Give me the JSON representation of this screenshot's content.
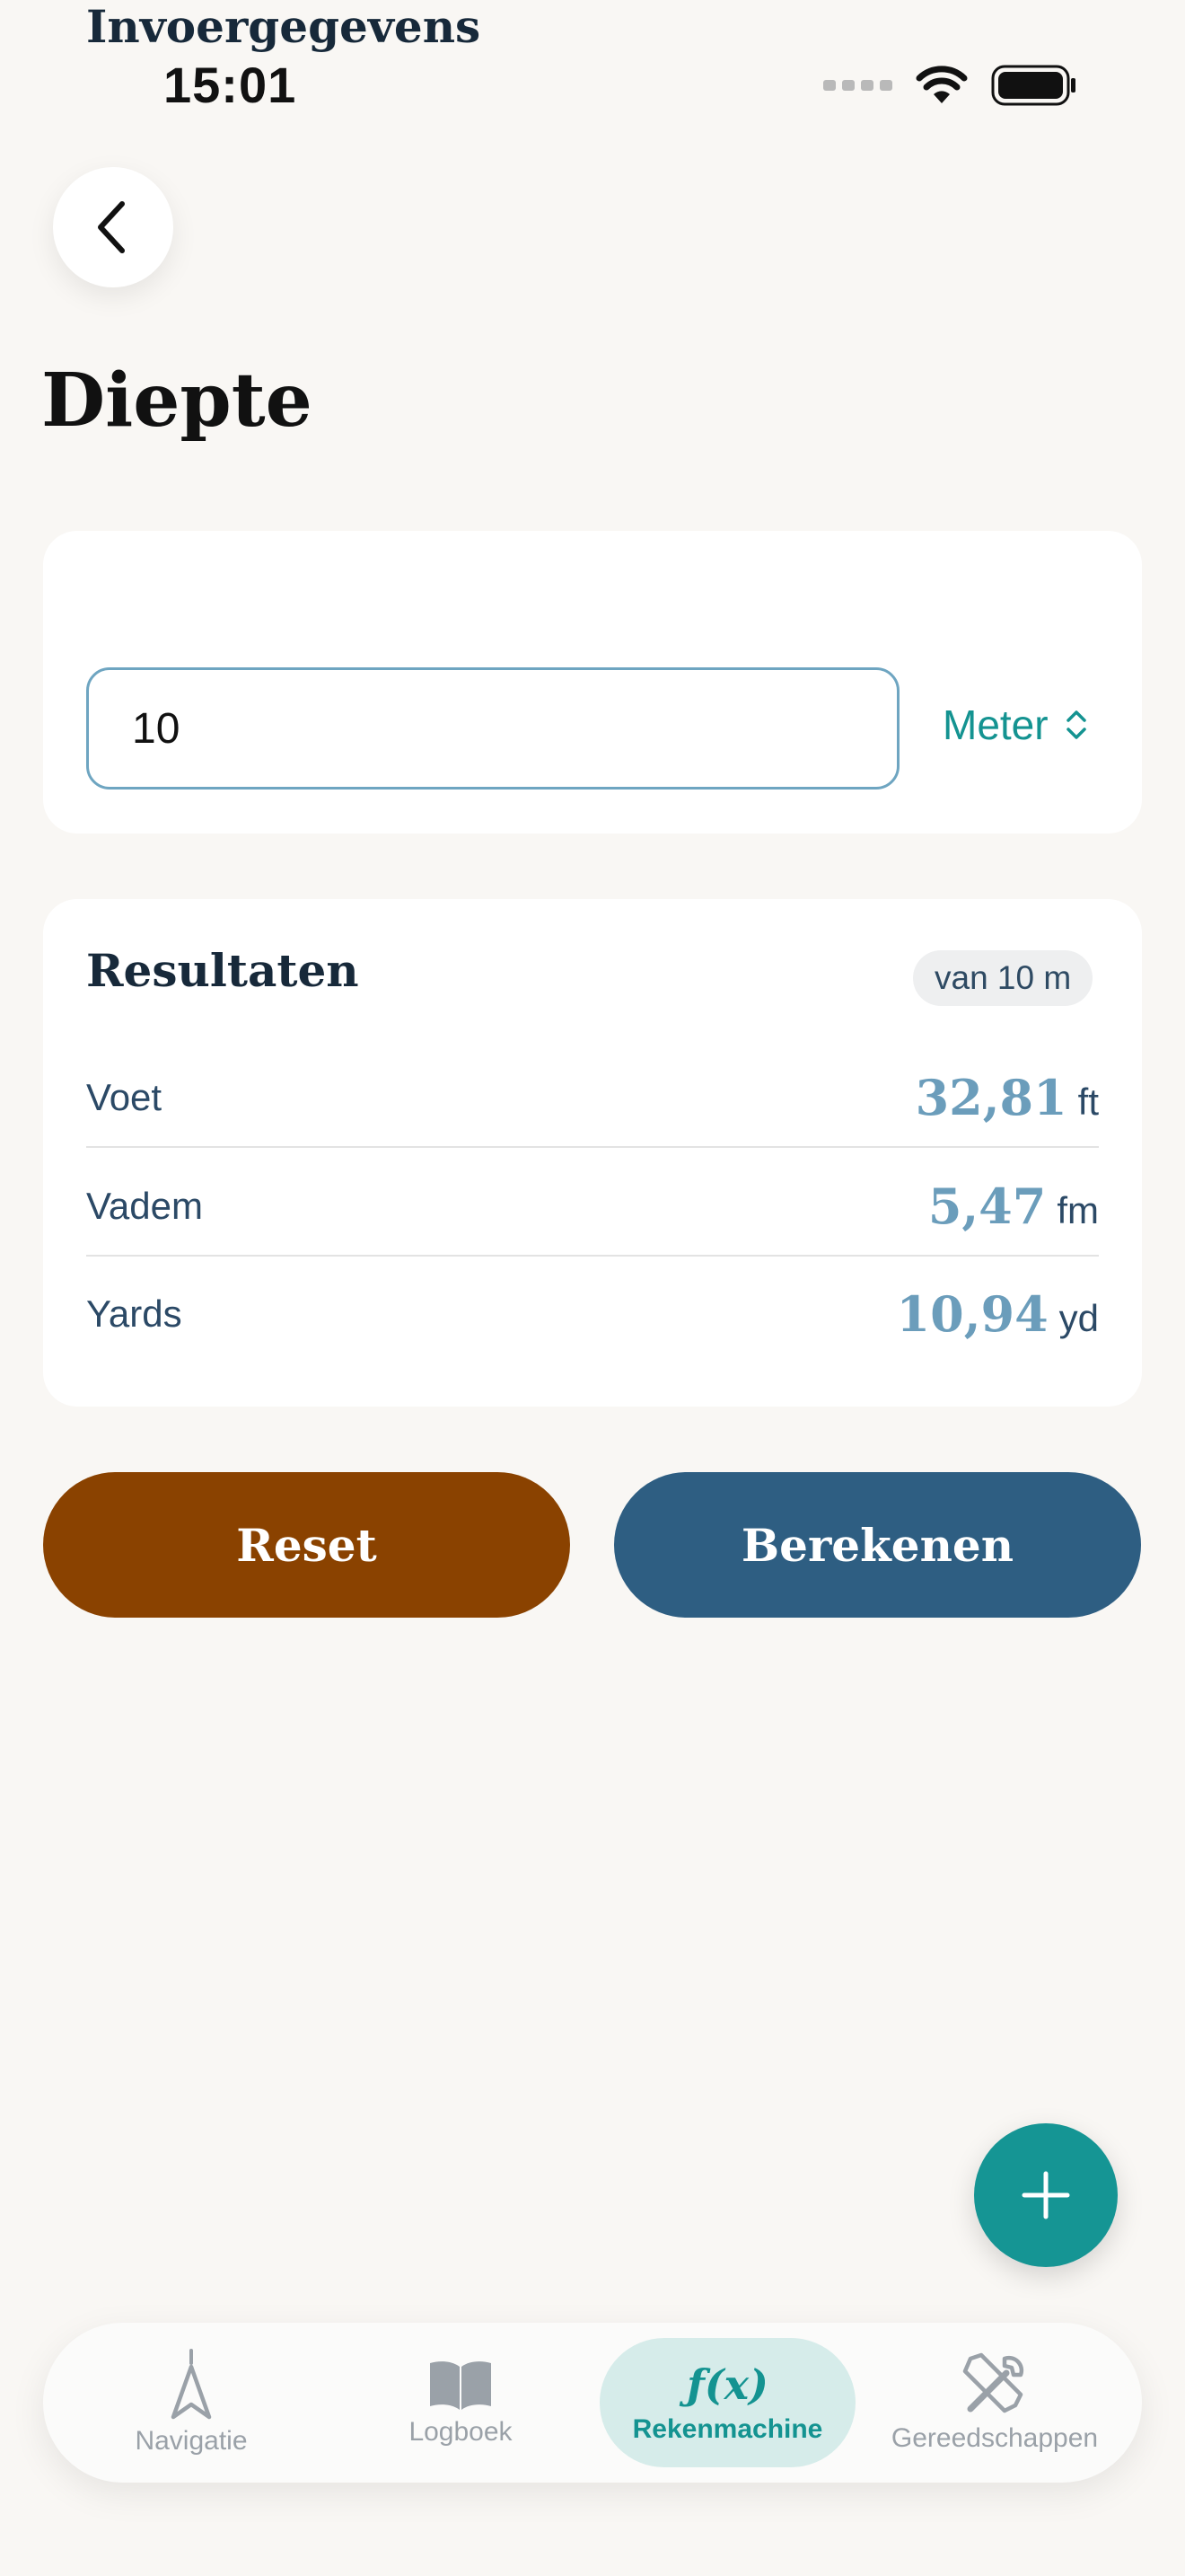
{
  "status_bar": {
    "time": "15:01"
  },
  "page": {
    "title": "Diepte"
  },
  "input_card": {
    "title": "Invoergegevens",
    "value": "10",
    "unit": "Meter"
  },
  "results": {
    "title": "Resultaten",
    "badge": "van 10 m",
    "rows": [
      {
        "label": "Voet",
        "value": "32,81",
        "unit": "ft"
      },
      {
        "label": "Vadem",
        "value": "5,47",
        "unit": "fm"
      },
      {
        "label": "Yards",
        "value": "10,94",
        "unit": "yd"
      }
    ]
  },
  "buttons": {
    "reset": "Reset",
    "calculate": "Berekenen"
  },
  "tabs": [
    {
      "label": "Navigatie",
      "icon": "navigation-arrow-icon"
    },
    {
      "label": "Logboek",
      "icon": "book-icon"
    },
    {
      "label": "Rekenmachine",
      "icon": "function-icon",
      "icon_text": "ƒ(x)",
      "active": true
    },
    {
      "label": "Gereedschappen",
      "icon": "tools-icon"
    }
  ],
  "colors": {
    "accent": "#149391",
    "reset": "#8a4200",
    "calculate": "#2e5e82",
    "result_value": "#6b9dbb"
  }
}
